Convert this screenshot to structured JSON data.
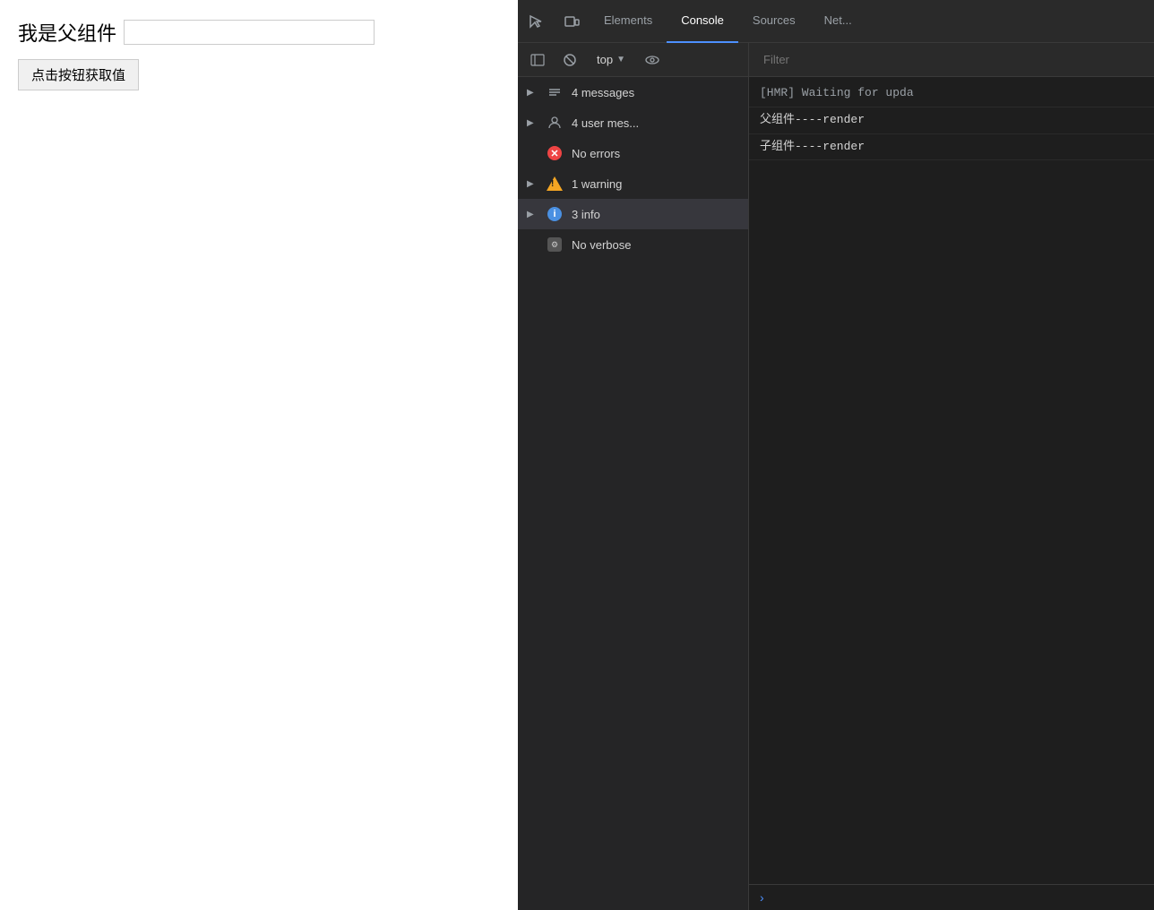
{
  "webpage": {
    "title": "我是父组件",
    "input_placeholder": "",
    "button_label": "点击按钮获取值"
  },
  "devtools": {
    "tabs": [
      {
        "id": "elements",
        "label": "Elements",
        "active": false
      },
      {
        "id": "console",
        "label": "Console",
        "active": true
      },
      {
        "id": "sources",
        "label": "Sources",
        "active": false
      },
      {
        "id": "network",
        "label": "Net...",
        "active": false
      }
    ],
    "toolbar": {
      "top_label": "top",
      "filter_placeholder": "Filter"
    },
    "filter_items": [
      {
        "id": "messages",
        "label": "4 messages",
        "icon": "messages",
        "has_arrow": true,
        "selected": false
      },
      {
        "id": "user_messages",
        "label": "4 user mes...",
        "icon": "user",
        "has_arrow": true,
        "selected": false
      },
      {
        "id": "errors",
        "label": "No errors",
        "icon": "error",
        "has_arrow": false,
        "selected": false
      },
      {
        "id": "warnings",
        "label": "1 warning",
        "icon": "warning",
        "has_arrow": true,
        "selected": false
      },
      {
        "id": "info",
        "label": "3 info",
        "icon": "info",
        "has_arrow": true,
        "selected": true
      },
      {
        "id": "verbose",
        "label": "No verbose",
        "icon": "verbose",
        "has_arrow": false,
        "selected": false
      }
    ],
    "console_messages": [
      {
        "id": "hmr",
        "text": "[HMR] Waiting for upda",
        "type": "hmr"
      },
      {
        "id": "parent_render",
        "text": "父组件----render",
        "type": "render"
      },
      {
        "id": "child_render",
        "text": "子组件----render",
        "type": "render"
      }
    ]
  }
}
